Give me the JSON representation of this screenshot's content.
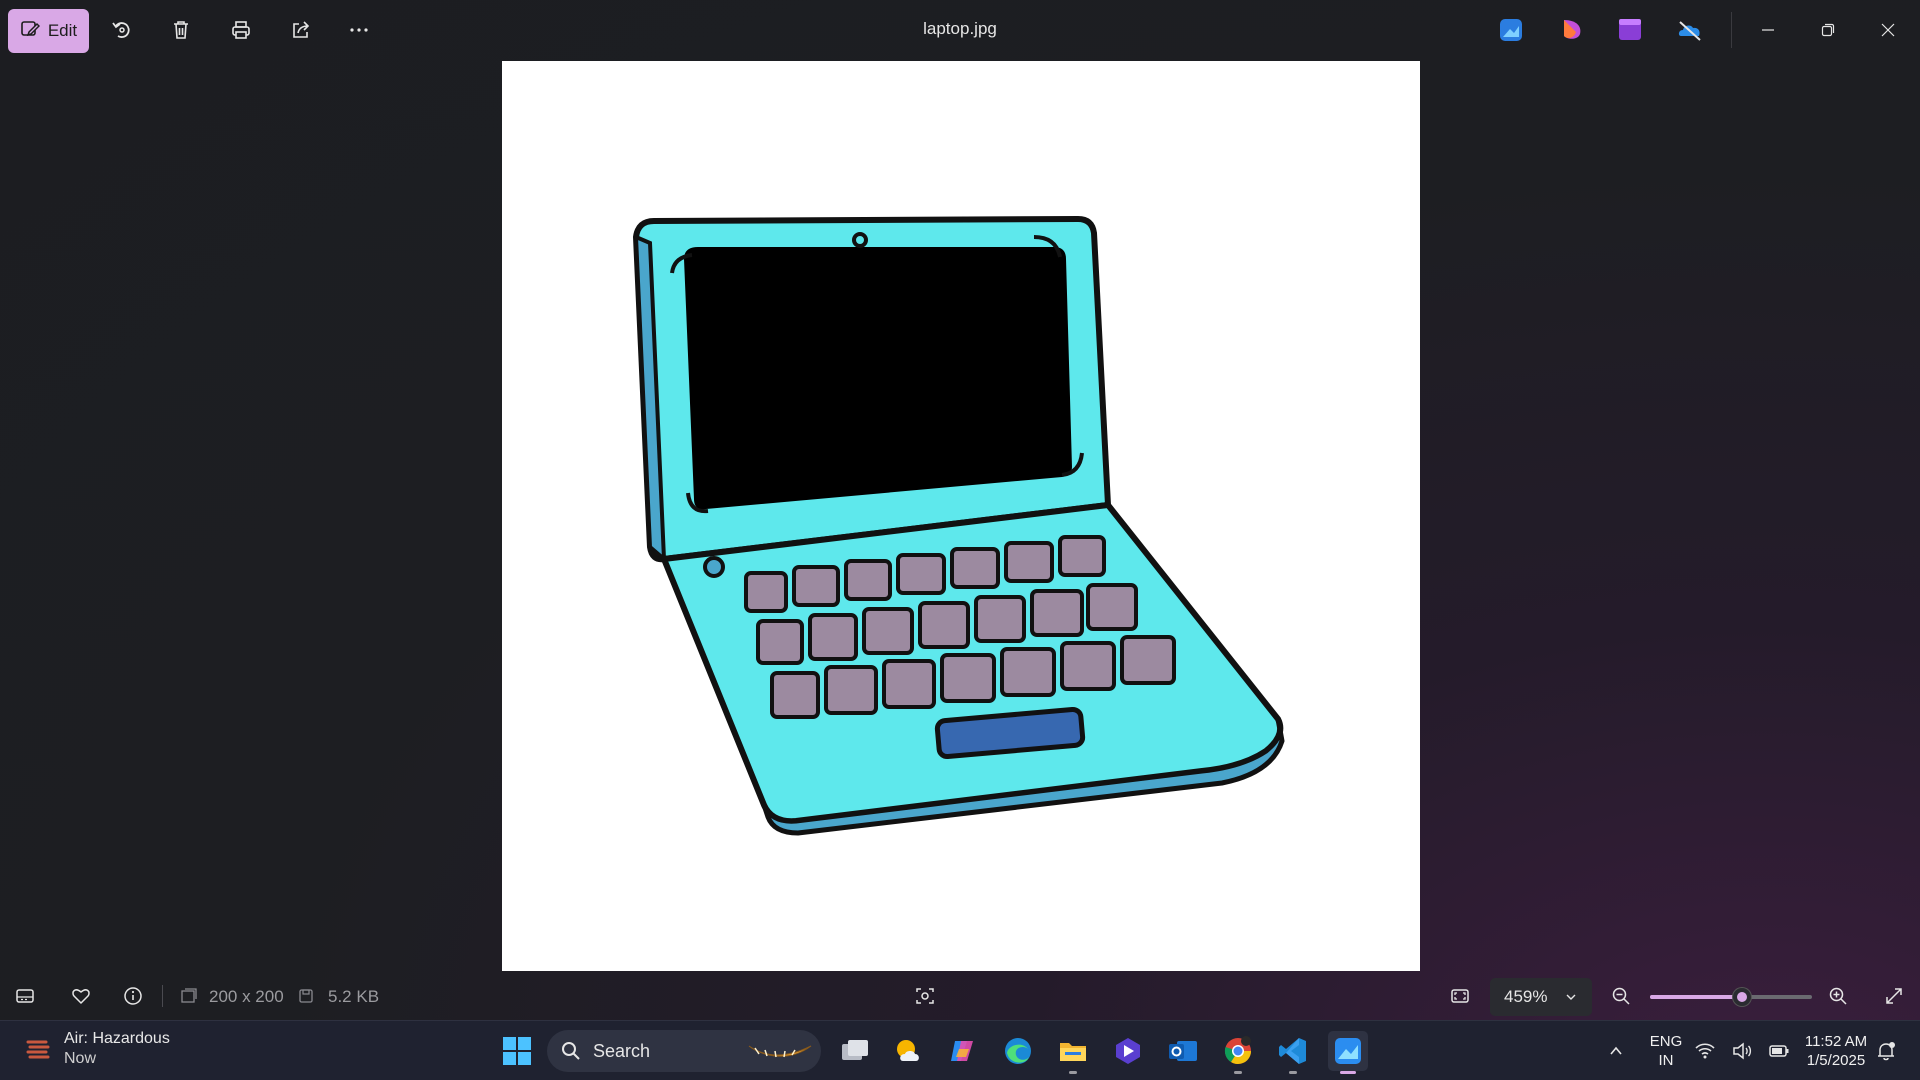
{
  "toolbar": {
    "edit_label": "Edit",
    "title": "laptop.jpg"
  },
  "statusbar": {
    "dimensions": "200 x 200",
    "file_size": "5.2 KB",
    "zoom": "459%",
    "zoom_level_fraction": 0.57
  },
  "taskbar": {
    "weather_title": "Air: Hazardous",
    "weather_sub": "Now",
    "search_label": "Search",
    "lang_top": "ENG",
    "lang_bottom": "IN",
    "time": "11:52 AM",
    "date": "1/5/2025"
  },
  "colors": {
    "accent": "#d9a8e6",
    "laptop_body": "#5ee8ec",
    "laptop_shadow": "#4aa6cc",
    "keys": "#9c8aa0",
    "touchpad": "#3768b0"
  }
}
